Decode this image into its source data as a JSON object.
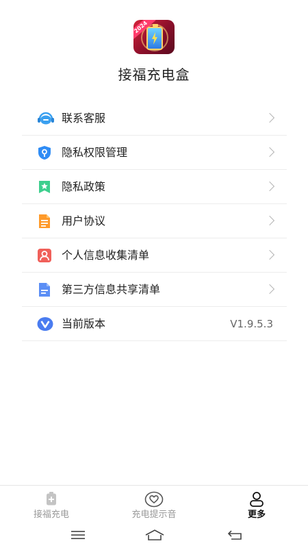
{
  "header": {
    "app_icon_badge": "2024",
    "app_name": "接福充电盒"
  },
  "menu": {
    "items": [
      {
        "label": "联系客服",
        "icon": "headset-icon",
        "color": "#3aa0f0"
      },
      {
        "label": "隐私权限管理",
        "icon": "privacy-shield-icon",
        "color": "#2f8cf5"
      },
      {
        "label": "隐私政策",
        "icon": "bookmark-star-icon",
        "color": "#3ecf8e"
      },
      {
        "label": "用户协议",
        "icon": "document-icon",
        "color": "#ff9a2a"
      },
      {
        "label": "个人信息收集清单",
        "icon": "person-card-icon",
        "color": "#f0605a"
      },
      {
        "label": "第三方信息共享清单",
        "icon": "file-lines-icon",
        "color": "#5b8ef5"
      },
      {
        "label": "当前版本",
        "icon": "version-v-icon",
        "color": "#4a7cf0",
        "value": "V1.9.5.3"
      }
    ]
  },
  "bottom_nav": {
    "tabs": [
      {
        "label": "接福充电",
        "icon": "battery-plus-icon",
        "active": false
      },
      {
        "label": "充电提示音",
        "icon": "heart-circle-icon",
        "active": false
      },
      {
        "label": "更多",
        "icon": "user-icon",
        "active": true
      }
    ]
  },
  "system_nav": {
    "buttons": [
      "menu-icon",
      "home-icon",
      "back-icon"
    ]
  }
}
